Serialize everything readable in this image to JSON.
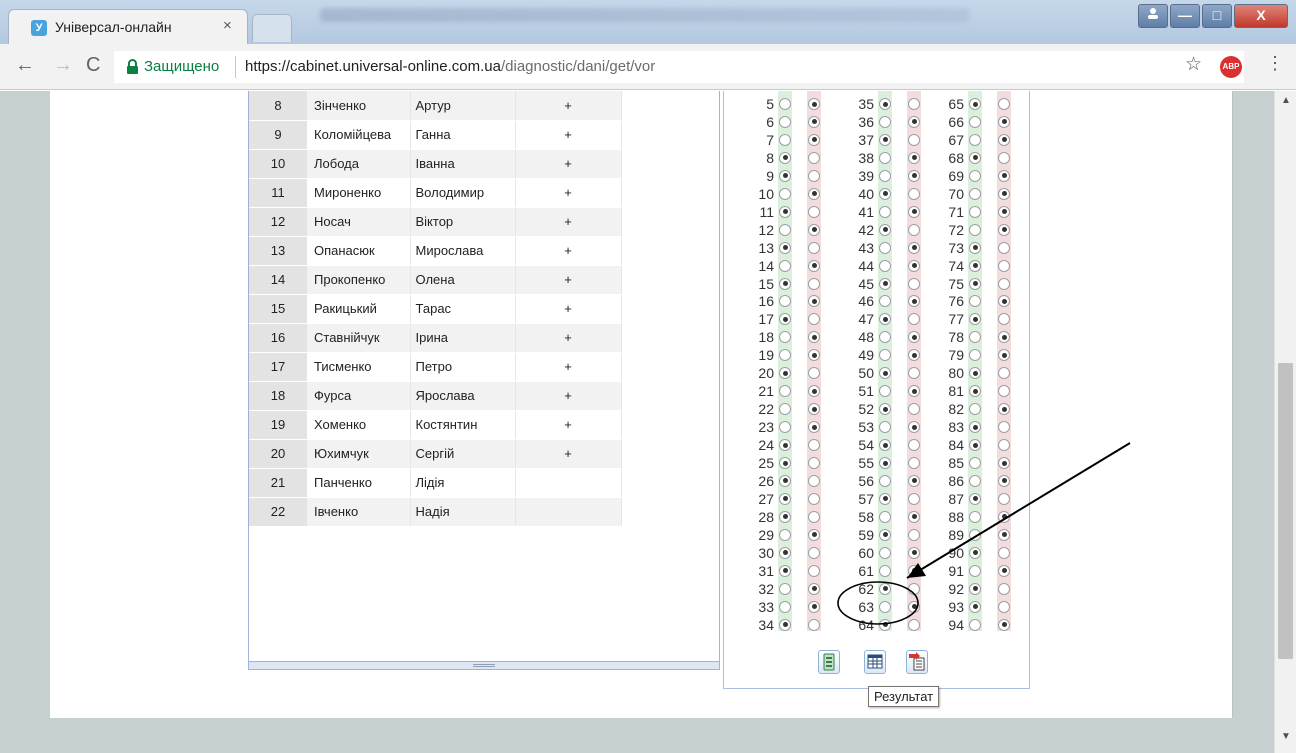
{
  "browser": {
    "tab_title": "Універсал-онлайн",
    "tab_close": "×",
    "secure_label": "Защищено",
    "url_host": "https://cabinet.universal-online.com.ua",
    "url_path": "/diagnostic/dani/get/vor",
    "adblock_label": "ABP",
    "window_buttons": {
      "minimize": "—",
      "maximize": "□",
      "close": "X"
    },
    "icons": {
      "back": "back-arrow-icon",
      "forward": "forward-arrow-icon",
      "reload": "reload-icon",
      "lock": "lock-icon",
      "bookmark": "star-icon",
      "menu": "kebab-menu-icon"
    }
  },
  "students": {
    "rows": [
      {
        "num": "8",
        "last": "Зінченко",
        "first": "Артур",
        "mark": "+"
      },
      {
        "num": "9",
        "last": "Коломійцева",
        "first": "Ганна",
        "mark": "+"
      },
      {
        "num": "10",
        "last": "Лобода",
        "first": "Іванна",
        "mark": "+"
      },
      {
        "num": "11",
        "last": "Мироненко",
        "first": "Володимир",
        "mark": "+"
      },
      {
        "num": "12",
        "last": "Носач",
        "first": "Віктор",
        "mark": "+"
      },
      {
        "num": "13",
        "last": "Опанасюк",
        "first": "Мирослава",
        "mark": "+"
      },
      {
        "num": "14",
        "last": "Прокопенко",
        "first": "Олена",
        "mark": "+"
      },
      {
        "num": "15",
        "last": "Ракицький",
        "first": "Тарас",
        "mark": "+"
      },
      {
        "num": "16",
        "last": "Ставнійчук",
        "first": "Ірина",
        "mark": "+"
      },
      {
        "num": "17",
        "last": "Тисменко",
        "first": "Петро",
        "mark": "+"
      },
      {
        "num": "18",
        "last": "Фурса",
        "first": "Ярослава",
        "mark": "+"
      },
      {
        "num": "19",
        "last": "Хоменко",
        "first": "Костянтин",
        "mark": "+"
      },
      {
        "num": "20",
        "last": "Юхимчук",
        "first": "Сергій",
        "mark": "+"
      },
      {
        "num": "21",
        "last": "Панченко",
        "first": "Лідія",
        "mark": ""
      },
      {
        "num": "22",
        "last": "Івченко",
        "first": "Надія",
        "mark": ""
      }
    ]
  },
  "answers": {
    "columns": [
      {
        "start": 5,
        "choices": [
          2,
          2,
          2,
          1,
          1,
          2,
          1,
          2,
          1,
          2,
          1,
          2,
          1,
          2,
          2,
          1,
          2,
          2,
          2,
          1,
          1,
          1,
          1,
          1,
          2,
          1,
          1,
          2,
          2,
          1
        ]
      },
      {
        "start": 35,
        "choices": [
          1,
          2,
          1,
          2,
          2,
          1,
          2,
          1,
          2,
          2,
          1,
          2,
          1,
          2,
          2,
          1,
          2,
          1,
          2,
          1,
          1,
          2,
          1,
          2,
          1,
          2,
          2,
          1,
          2,
          1
        ]
      },
      {
        "start": 65,
        "choices": [
          1,
          2,
          2,
          1,
          2,
          2,
          2,
          2,
          1,
          1,
          1,
          2,
          1,
          2,
          2,
          1,
          1,
          2,
          1,
          1,
          2,
          2,
          1,
          2,
          2,
          1,
          2,
          1,
          1,
          2
        ]
      }
    ],
    "buttons": {
      "form": "answer-form-icon",
      "table": "table-icon",
      "result": "result-icon"
    },
    "tooltip": "Результат"
  },
  "colors": {
    "choice_a_stripe": "#dcefdc",
    "choice_b_stripe": "#f3dcdc",
    "secure_green": "#0b8043",
    "tab_accent": "#4aa3df"
  }
}
